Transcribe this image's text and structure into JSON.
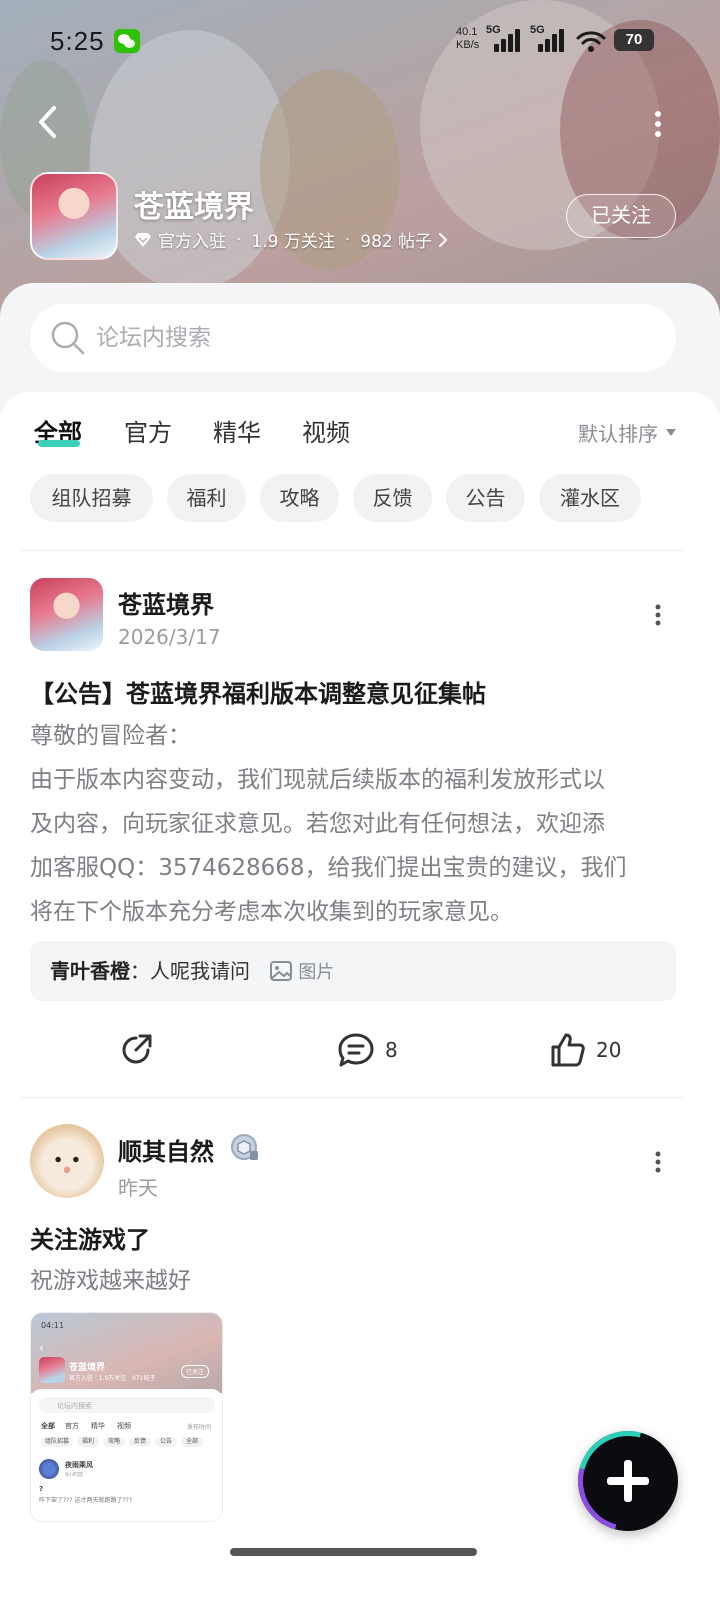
{
  "status_bar": {
    "time": "5:25",
    "net_speed_value": "40.1",
    "net_speed_unit": "KB/s",
    "net_type_1": "5G",
    "net_type_2": "5G",
    "battery": "70"
  },
  "forum": {
    "title": "苍蓝境界",
    "verified_label": "官方入驻",
    "followers": "1.9 万关注",
    "posts": "982 帖子",
    "follow_button": "已关注"
  },
  "search": {
    "placeholder": "论坛内搜索"
  },
  "tabs": [
    {
      "label": "全部",
      "active": true
    },
    {
      "label": "官方",
      "active": false
    },
    {
      "label": "精华",
      "active": false
    },
    {
      "label": "视频",
      "active": false
    }
  ],
  "sort_label": "默认排序",
  "chips": [
    "组队招募",
    "福利",
    "攻略",
    "反馈",
    "公告",
    "灌水区"
  ],
  "posts": [
    {
      "author": "苍蓝境界",
      "date": "2026/3/17",
      "title": "【公告】苍蓝境界福利版本调整意见征集帖",
      "body_lines": [
        "尊敬的冒险者：",
        "由于版本内容变动，我们现就后续版本的福利发放形式以",
        "及内容，向玩家征求意见。若您对此有任何想法，欢迎添",
        "加客服QQ：3574628668，给我们提出宝贵的建议，我们",
        "将在下个版本充分考虑本次收集到的玩家意见。"
      ],
      "top_comment": {
        "author": "青叶香橙",
        "text": "人呢我请问",
        "image_label": "图片"
      },
      "comments": "8",
      "likes": "20"
    },
    {
      "author": "顺其自然",
      "date": "昨天",
      "title": "关注游戏了",
      "body": "祝游戏越来越好",
      "thumb": {
        "time": "04:11",
        "title": "苍蓝境界",
        "meta": "官方入驻 · 1.9万关注 · 971帖子",
        "follow": "已关注",
        "search": "论坛内搜索",
        "tabs": [
          "全部",
          "官方",
          "精华",
          "视频"
        ],
        "sort": "发布时间",
        "chips": [
          "组队招募",
          "福利",
          "攻略",
          "反馈",
          "公告",
          "全部"
        ],
        "post_author": "夜雨乘风",
        "post_time": "9小时前",
        "post_title": "?",
        "post_body": "咋下架了??? 这才两天就跑路了???"
      }
    }
  ],
  "colors": {
    "accent": "#3ad1b8",
    "chip_bg": "#f1f2f4",
    "muted_text": "#7d8085"
  }
}
